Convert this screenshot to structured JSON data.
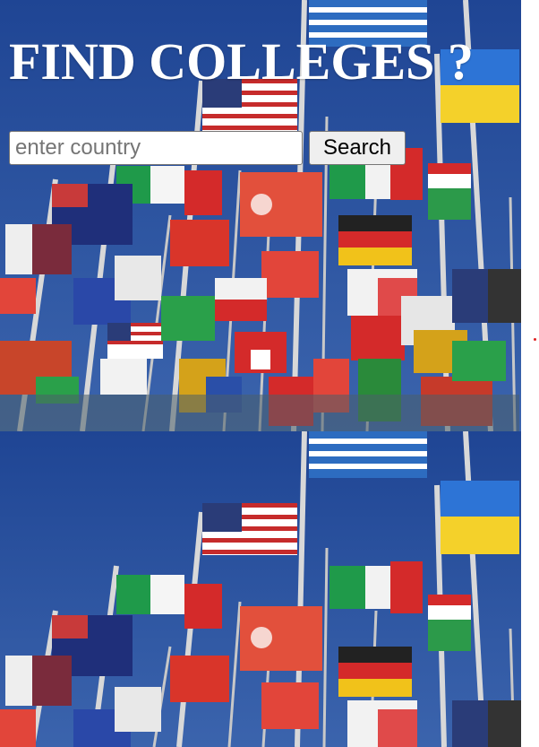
{
  "header": {
    "title": "FIND COLLEGES ?"
  },
  "search": {
    "placeholder": "enter country",
    "value": "",
    "button_label": "Search"
  },
  "background": {
    "image_subject": "flags-of-the-world-on-flagpoles",
    "sky_color": "#2a4f9a"
  },
  "marker": {
    "color": "#e02020"
  }
}
